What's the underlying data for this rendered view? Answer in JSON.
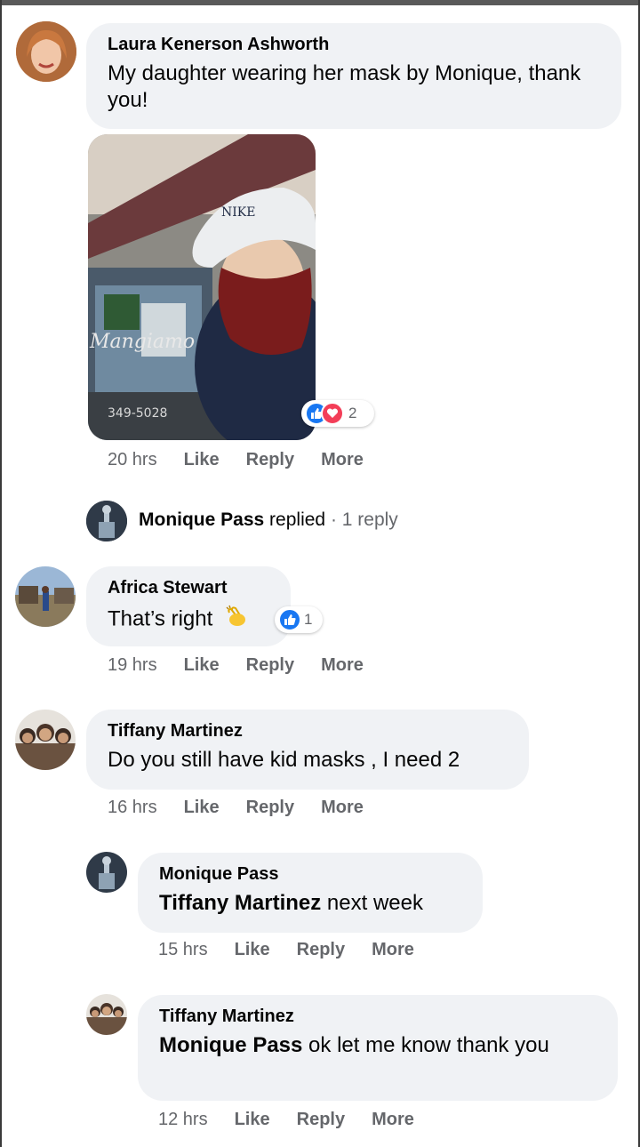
{
  "comments": [
    {
      "author": "Laura Kenerson Ashworth",
      "text": "My daughter wearing her mask by Monique, thank you!",
      "photo_text": {
        "sign": "Mangiamo",
        "phone": "349-5028",
        "cap": "NIKE"
      },
      "reaction_count": "2",
      "time": "20 hrs",
      "like": "Like",
      "reply": "Reply",
      "more": "More"
    },
    {
      "replied": {
        "name": "Monique Pass",
        "verb": "replied",
        "dot": "·",
        "count": "1 reply"
      }
    },
    {
      "author": "Africa Stewart",
      "text": "That’s right",
      "reaction_count": "1",
      "time": "19 hrs",
      "like": "Like",
      "reply": "Reply",
      "more": "More"
    },
    {
      "author": "Tiffany Martinez",
      "text": "Do you still have kid masks , I need 2",
      "time": "16 hrs",
      "like": "Like",
      "reply": "Reply",
      "more": "More"
    },
    {
      "author": "Monique Pass",
      "mention": "Tiffany Martinez",
      "text": "next week",
      "time": "15 hrs",
      "like": "Like",
      "reply": "Reply",
      "more": "More"
    },
    {
      "author": "Tiffany Martinez",
      "mention": "Monique Pass",
      "text": "ok let me know thank you",
      "time": "12 hrs",
      "like": "Like",
      "reply": "Reply",
      "more": "More"
    }
  ],
  "colors": {
    "bubble": "#f0f2f5",
    "meta_text": "#65676b",
    "like_blue": "#1877f2",
    "love_red": "#f33e58"
  },
  "icons": [
    "like-reaction-icon",
    "love-reaction-icon",
    "clap-emoji-icon"
  ]
}
